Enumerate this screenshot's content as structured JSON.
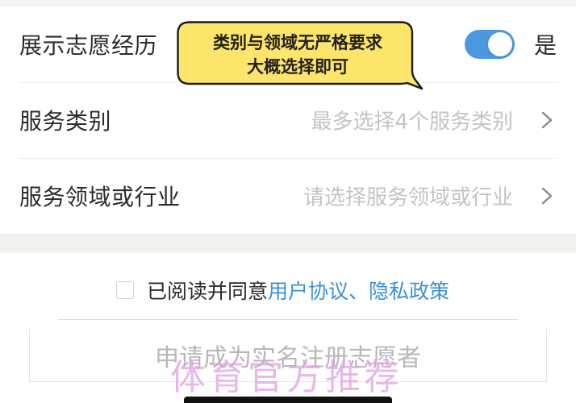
{
  "form": {
    "show_experience": {
      "label": "展示志愿经历",
      "toggle_on": true,
      "toggle_text": "是"
    },
    "service_category": {
      "label": "服务类别",
      "placeholder": "最多选择4个服务类别"
    },
    "service_field": {
      "label": "服务领域或行业",
      "placeholder": "请选择服务领域或行业"
    }
  },
  "agreement": {
    "checked": false,
    "text": "已阅读并同意",
    "link": "用户协议、隐私政策"
  },
  "submit": {
    "label": "申请成为实名注册志愿者"
  },
  "annotation": {
    "line1": "类别与领域无严格要求",
    "line2": "大概选择即可"
  },
  "watermark": {
    "text": "体育官方推荐"
  },
  "colors": {
    "accent": "#4a98df",
    "link": "#3c8fd8",
    "bubble_fill": "#fde46a"
  },
  "icons": {
    "chevron": "chevron-right-icon"
  }
}
